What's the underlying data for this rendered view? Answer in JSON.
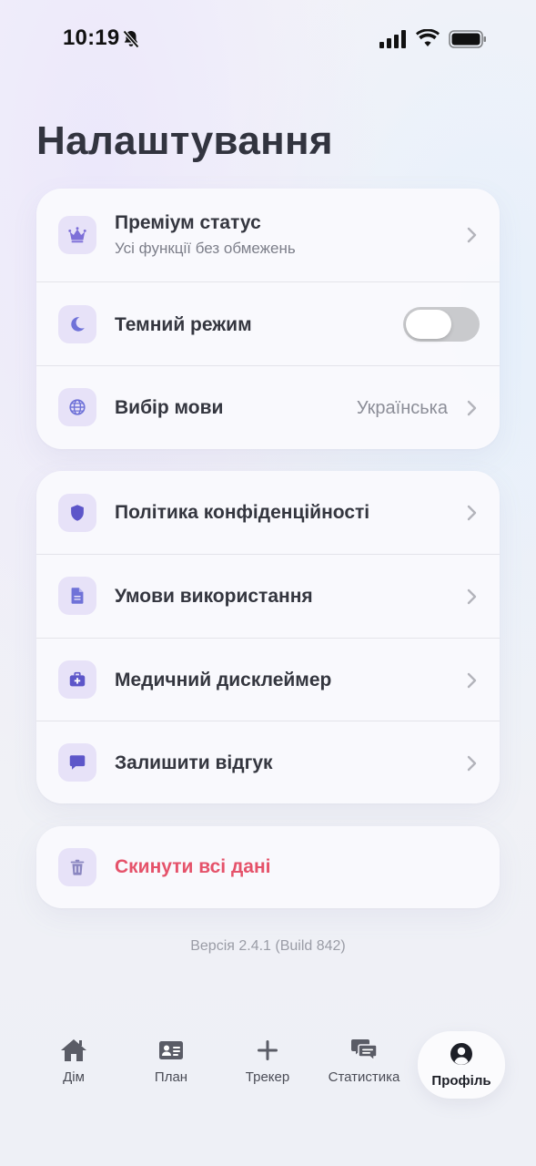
{
  "status_bar": {
    "time": "10:19"
  },
  "page": {
    "title": "Налаштування"
  },
  "settings_group_1": {
    "premium": {
      "title": "Преміум статус",
      "subtitle": "Усі функції без обмежень",
      "icon": "crown-icon"
    },
    "dark_mode": {
      "title": "Темний режим",
      "enabled": false,
      "icon": "moon-icon"
    },
    "language": {
      "title": "Вибір мови",
      "value": "Українська",
      "icon": "globe-icon"
    }
  },
  "settings_group_2": {
    "privacy": {
      "title": "Політика конфіденційності",
      "icon": "shield-icon"
    },
    "terms": {
      "title": "Умови використання",
      "icon": "document-icon"
    },
    "disclaimer": {
      "title": "Медичний дисклеймер",
      "icon": "medkit-icon"
    },
    "feedback": {
      "title": "Залишити відгук",
      "icon": "chat-bubble-icon"
    }
  },
  "danger_zone": {
    "reset": {
      "title": "Скинути всі дані",
      "icon": "trash-icon"
    }
  },
  "footer": {
    "version": "Версія 2.4.1 (Build 842)"
  },
  "tabbar": {
    "tabs": [
      {
        "label": "Дім",
        "icon": "home-icon"
      },
      {
        "label": "План",
        "icon": "id-card-icon"
      },
      {
        "label": "Трекер",
        "icon": "plus-icon"
      },
      {
        "label": "Статистика",
        "icon": "chat-icon"
      },
      {
        "label": "Профіль",
        "icon": "user-icon",
        "active": true
      }
    ]
  },
  "colors": {
    "accent": "#6f63d8",
    "icon_bg": "#e7e2f8",
    "danger": "#e5526a",
    "toggle_off": "#c9cacd"
  }
}
